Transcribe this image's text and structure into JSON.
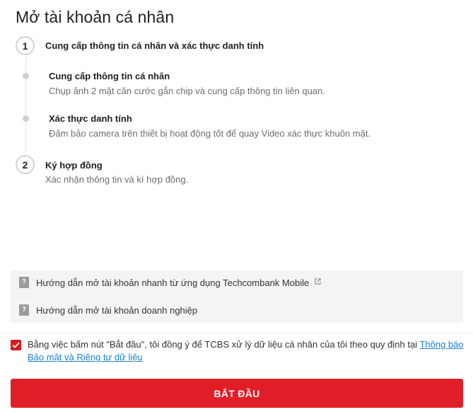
{
  "page": {
    "title": "Mở tài khoản cá nhân"
  },
  "steps": [
    {
      "number": "1",
      "title": "Cung cấp thông tin cá nhân và xác thực danh tính",
      "substeps": [
        {
          "title": "Cung cấp thông tin cá nhân",
          "description": "Chụp ảnh 2 mặt căn cước gắn chip và cung cấp thông tin liên quan."
        },
        {
          "title": "Xác thực danh tính",
          "description": "Đảm bảo camera trên thiết bị hoạt động tốt để quay Video xác thực khuôn mặt."
        }
      ]
    },
    {
      "number": "2",
      "title": "Ký hợp đồng",
      "description": "Xác nhận thông tin và kí hợp đồng."
    }
  ],
  "guides": [
    {
      "label": "Hướng dẫn mở tài khoản nhanh từ ứng dụng Techcombank Mobile",
      "icon": "help-icon",
      "external_icon": "external-link-icon"
    },
    {
      "label": "Hướng dẫn mở tài khoản doanh nghiệp",
      "icon": "help-icon"
    }
  ],
  "consent": {
    "checked": true,
    "text": "Bằng việc bấm nút \"Bắt đầu\", tôi đồng ý để TCBS xử lý dữ liệu cá nhân của tôi theo quy định tại ",
    "link_text": "Thông báo Bảo mật và Riêng tư dữ liệu"
  },
  "start_button": {
    "label": "BẮT ĐẦU"
  },
  "colors": {
    "accent": "#e01e27",
    "link": "#1a7fd1",
    "guide_bg": "#f4f4f4"
  }
}
